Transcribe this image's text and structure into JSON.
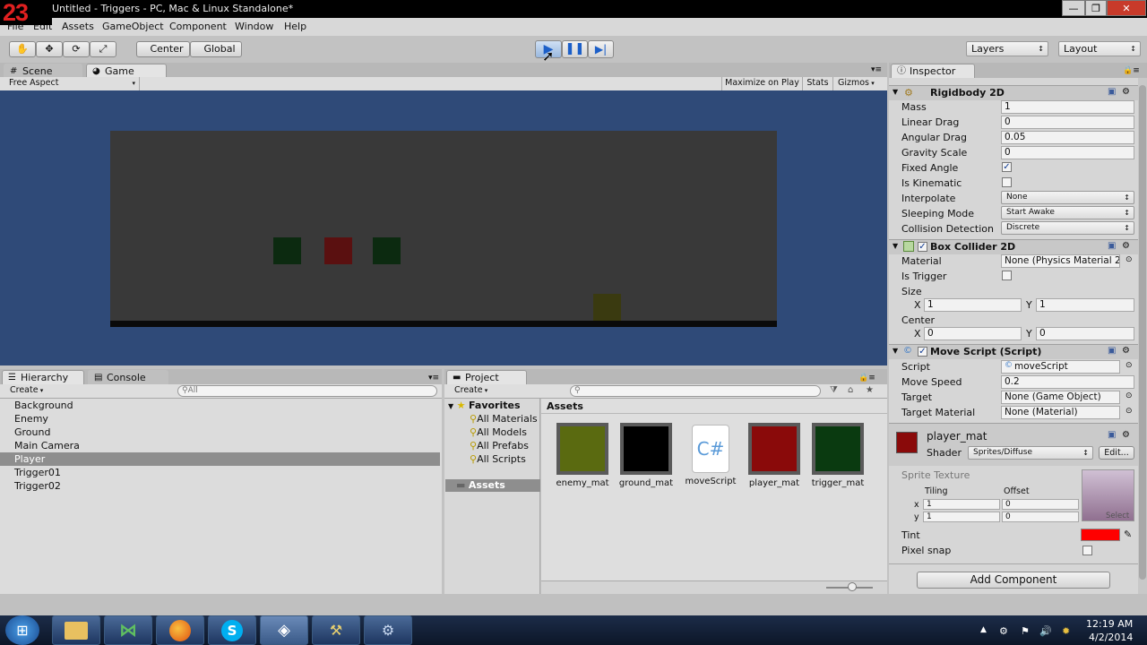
{
  "logo_text": "23",
  "window": {
    "title": "Untitled - Triggers - PC, Mac & Linux Standalone*",
    "min": "—",
    "max": "❐",
    "close": "✕"
  },
  "menu": [
    "File",
    "Edit",
    "Assets",
    "GameObject",
    "Component",
    "Window",
    "Help"
  ],
  "toolbar": {
    "pivot": "Center",
    "space": "Global",
    "layers": "Layers",
    "layout": "Layout"
  },
  "game_tabs": {
    "scene": "Scene",
    "game": "Game"
  },
  "game_bar": {
    "aspect": "Free Aspect",
    "maximize": "Maximize on Play",
    "stats": "Stats",
    "gizmos": "Gizmos"
  },
  "game_view": {
    "background": "#2f4a78",
    "panel": "#393939",
    "ground": "#0a0a0a",
    "squares": [
      {
        "color": "#0c2a10"
      },
      {
        "color": "#5a1010"
      },
      {
        "color": "#0c2a10"
      },
      {
        "color": "#3a3a10"
      }
    ]
  },
  "hierarchy": {
    "tab": "Hierarchy",
    "console_tab": "Console",
    "create": "Create",
    "search_placeholder": "All",
    "items": [
      "Background",
      "Enemy",
      "Ground",
      "Main Camera",
      "Player",
      "Trigger01",
      "Trigger02"
    ],
    "selected": "Player"
  },
  "project": {
    "tab": "Project",
    "create": "Create",
    "favorites_label": "Favorites",
    "favorites": [
      "All Materials",
      "All Models",
      "All Prefabs",
      "All Scripts"
    ],
    "assets_label": "Assets",
    "assets_header": "Assets",
    "assets": [
      {
        "name": "enemy_mat",
        "color": "#5a6a10"
      },
      {
        "name": "ground_mat",
        "color": "#000000"
      },
      {
        "name": "moveScript",
        "color": "#ffffff"
      },
      {
        "name": "player_mat",
        "color": "#8a0a0a"
      },
      {
        "name": "trigger_mat",
        "color": "#0a3a10"
      }
    ]
  },
  "inspector": {
    "tab": "Inspector",
    "rigidbody": {
      "title": "Rigidbody 2D",
      "rows": [
        {
          "label": "Mass",
          "value": "1"
        },
        {
          "label": "Linear Drag",
          "value": "0"
        },
        {
          "label": "Angular Drag",
          "value": "0.05"
        },
        {
          "label": "Gravity Scale",
          "value": "0"
        }
      ],
      "fixed_angle_label": "Fixed Angle",
      "fixed_angle": "✓",
      "kinematic_label": "Is Kinematic",
      "interpolate_label": "Interpolate",
      "interpolate": "None",
      "sleeping_label": "Sleeping Mode",
      "sleeping": "Start Awake",
      "collision_label": "Collision Detection",
      "collision": "Discrete"
    },
    "box_collider": {
      "title": "Box Collider 2D",
      "material_label": "Material",
      "material": "None (Physics Material 2",
      "trigger_label": "Is Trigger",
      "size_label": "Size",
      "size_x": "1",
      "size_y": "1",
      "center_label": "Center",
      "center_x": "0",
      "center_y": "0",
      "x": "X",
      "y": "Y"
    },
    "move_script": {
      "title": "Move Script (Script)",
      "script_label": "Script",
      "script": "moveScript",
      "speed_label": "Move Speed",
      "speed": "0.2",
      "target_label": "Target",
      "target": "None (Game Object)",
      "target_mat_label": "Target Material",
      "target_mat": "None (Material)"
    },
    "material": {
      "name": "player_mat",
      "color": "#8a0a0a",
      "shader_label": "Shader",
      "shader": "Sprites/Diffuse",
      "edit": "Edit...",
      "sprite_texture": "Sprite Texture",
      "tiling": "Tiling",
      "offset": "Offset",
      "tx": "1",
      "ty": "1",
      "ox": "0",
      "oy": "0",
      "x": "x",
      "y": "y",
      "select": "Select",
      "tint_label": "Tint",
      "tint_color": "#ff0000",
      "pixel_snap_label": "Pixel snap"
    },
    "add_component": "Add Component"
  },
  "taskbar": {
    "time": "12:19 AM",
    "date": "4/2/2014"
  }
}
